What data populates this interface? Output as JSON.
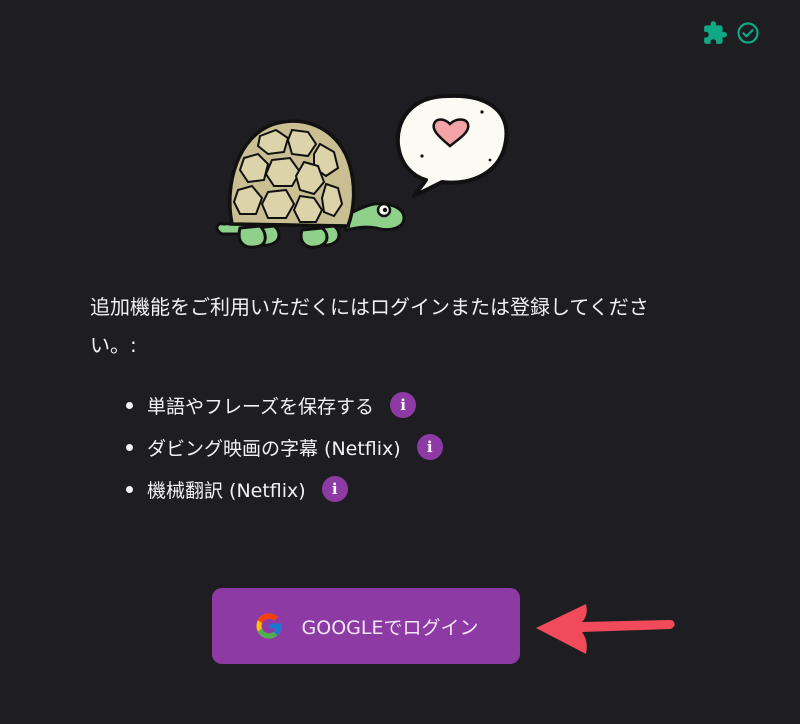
{
  "top_bar": {
    "icons": [
      "puzzle-icon",
      "check-circle-icon"
    ],
    "accent_color": "#0fa985"
  },
  "illustration": {
    "description_icon": "turtle-with-heart-speech-bubble"
  },
  "intro_text": "追加機能をご利用いただくにはログインまたは登録してください。:",
  "features": [
    {
      "label": "単語やフレーズを保存する",
      "icon": "info-icon"
    },
    {
      "label": "ダビング映画の字幕 (Netflix)",
      "icon": "info-icon"
    },
    {
      "label": "機械翻訳 (Netflix)",
      "icon": "info-icon"
    }
  ],
  "login": {
    "label": "GOOGLEでログイン",
    "icon": "google-icon",
    "color": "#8e3aa5"
  },
  "annotation": {
    "icon": "red-arrow-icon",
    "color": "#f04a5b"
  }
}
